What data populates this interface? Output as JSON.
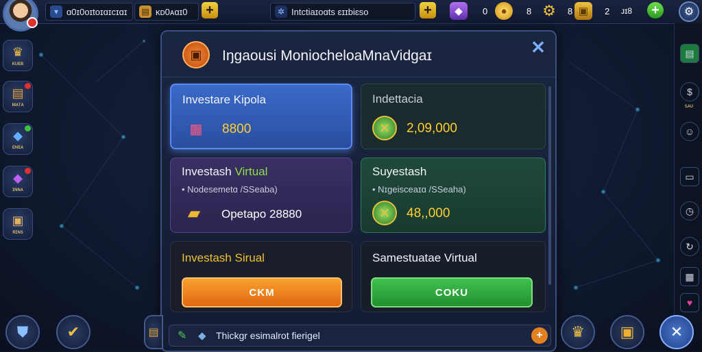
{
  "top_bar": {
    "player_name": "ɑ0ɪ0oɪtoɪɑɪcɪɑɪ",
    "resource_pill_1": {
      "label": "ᴋᴅ0ᴀɑɪ0",
      "icon": "crate-icon"
    },
    "event_pill": {
      "label": "Intctiaɪoɑts ɛɪɪbiɛso",
      "icon": "network-icon"
    },
    "gem_count": "0",
    "gold_count": "8",
    "gear_currency": "8",
    "box_currency": "2",
    "extra_currency": "ᴊɪ8"
  },
  "left_sidebar": [
    {
      "icon": "crown-icon",
      "caption": "ᴋᴜᴇʙ",
      "badge": false
    },
    {
      "icon": "chest-icon",
      "caption": "ᴍᴀᴛᴀ",
      "badge": true
    },
    {
      "icon": "cube-icon",
      "caption": "ᴇɴᴇᴀ",
      "badge": true
    },
    {
      "icon": "purple-box-icon",
      "caption": "ɪɴɴᴀ",
      "badge": true
    },
    {
      "icon": "crate-icon",
      "caption": "ʀɪɴs",
      "badge": false
    }
  ],
  "right_sidebar": [
    {
      "icon": "screen-icon",
      "caption": ""
    },
    {
      "icon": "coin-icon",
      "caption": "ꜱᴀᴜ"
    },
    {
      "icon": "person-icon",
      "caption": ""
    },
    {
      "icon": "board-icon",
      "caption": ""
    },
    {
      "icon": "clock-icon",
      "caption": ""
    },
    {
      "icon": "refresh-icon",
      "caption": ""
    },
    {
      "icon": "chat-icon",
      "caption": ""
    },
    {
      "icon": "bag-icon",
      "caption": ""
    }
  ],
  "dialog": {
    "title": "Iŋgaousi MoniocheloaMnaVidgaɪ",
    "cards": [
      {
        "title": "Investare Kipola",
        "value": "8800"
      },
      {
        "title": "Indettacia",
        "value": "2,09,000"
      },
      {
        "title": "Investash Virtual",
        "subtitle": "• Nodesemetɑ /SSeaba)",
        "value": "Opetapo 28880"
      },
      {
        "title": "Suyestash",
        "subtitle": "• Nɪgeisceaɪɑ /SSeaha)",
        "value": "48,,000"
      },
      {
        "title": "Investash Sirual",
        "button": "CKM"
      },
      {
        "title": "Samestuatae Virtual",
        "button": "COKU"
      }
    ],
    "footer_text": "Thickgr esimalrot fierigel"
  },
  "colors": {
    "accent_orange": "#f08a20",
    "accent_green": "#2fb040",
    "gold": "#f2c81a"
  }
}
